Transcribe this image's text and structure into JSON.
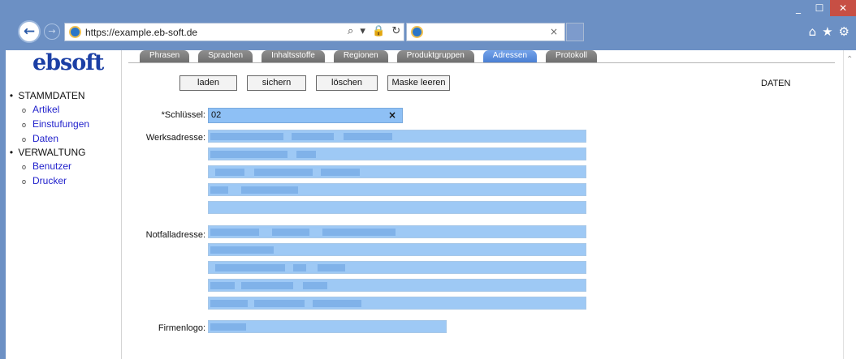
{
  "window": {
    "min": "_",
    "max": "☐",
    "close": "✕"
  },
  "browser": {
    "url": "https://example.eb-soft.de",
    "address_tools": "⌕ ▾ 🔒 ↻",
    "tab_close": "×",
    "icons": [
      "home-icon",
      "star-icon",
      "gear-icon"
    ],
    "icon_glyphs": [
      "⌂",
      "★",
      "⚙"
    ]
  },
  "sidebar": {
    "logo": "ebsoft",
    "sections": [
      {
        "label": "STAMMDATEN",
        "items": [
          "Artikel",
          "Einstufungen",
          "Daten"
        ]
      },
      {
        "label": "VERWALTUNG",
        "items": [
          "Benutzer",
          "Drucker"
        ]
      }
    ]
  },
  "tabs": [
    "Phrasen",
    "Sprachen",
    "Inhaltsstoffe",
    "Regionen",
    "Produktgruppen",
    "Adressen",
    "Protokoll"
  ],
  "active_tab": "Adressen",
  "toolbar": {
    "load": "laden",
    "save": "sichern",
    "delete": "löschen",
    "clear": "Maske leeren"
  },
  "mode_label": "DATEN",
  "form": {
    "key_label": "*Schlüssel:",
    "key_value": "02",
    "key_clear": "×",
    "works_label": "Werksadresse:",
    "emergency_label": "Notfalladresse:",
    "logo_label": "Firmenlogo:"
  }
}
